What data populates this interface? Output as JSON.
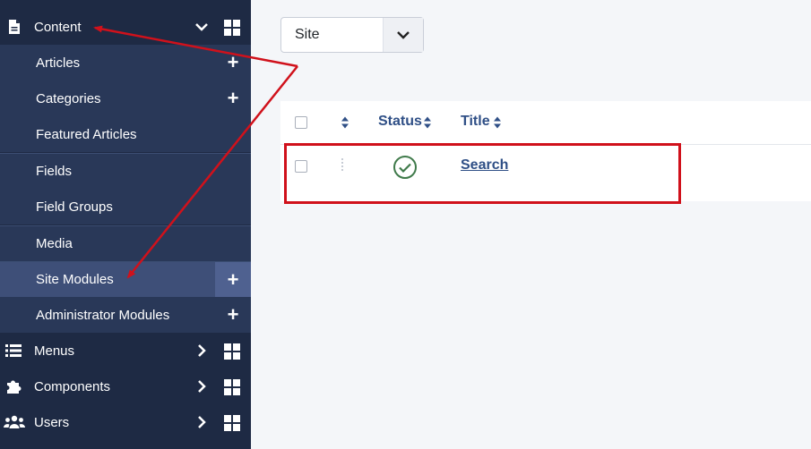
{
  "sidebar": {
    "content": "Content",
    "items": {
      "articles": "Articles",
      "categories": "Categories",
      "featured": "Featured Articles",
      "fields": "Fields",
      "field_groups": "Field Groups",
      "media": "Media",
      "site_modules": "Site Modules",
      "admin_modules": "Administrator Modules"
    },
    "menus": "Menus",
    "components": "Components",
    "users": "Users"
  },
  "filter": {
    "site_select": "Site"
  },
  "table": {
    "headers": {
      "status": "Status",
      "title": "Title"
    },
    "rows": [
      {
        "title": "Search",
        "status": "published"
      }
    ]
  },
  "colors": {
    "sidebar_bg": "#1e2a44",
    "active_bg": "#3e4f78",
    "link": "#2f4f86",
    "annotation_red": "#d0111b",
    "status_green": "#3f7a4a"
  }
}
